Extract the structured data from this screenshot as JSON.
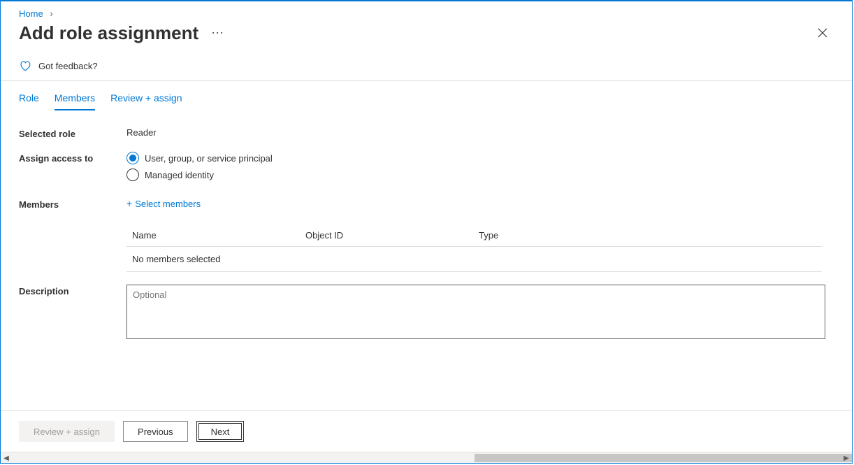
{
  "breadcrumb": {
    "home": "Home"
  },
  "title": "Add role assignment",
  "feedback": {
    "label": "Got feedback?"
  },
  "tabs": [
    {
      "key": "role",
      "label": "Role",
      "active": false
    },
    {
      "key": "members",
      "label": "Members",
      "active": true
    },
    {
      "key": "review",
      "label": "Review + assign",
      "active": false
    }
  ],
  "form": {
    "selected_role_label": "Selected role",
    "selected_role_value": "Reader",
    "assign_access_label": "Assign access to",
    "assign_access_options": [
      {
        "key": "usp",
        "label": "User, group, or service principal",
        "selected": true
      },
      {
        "key": "mi",
        "label": "Managed identity",
        "selected": false
      }
    ],
    "members_label": "Members",
    "select_members_link": "Select members",
    "members_table": {
      "headers": {
        "name": "Name",
        "object_id": "Object ID",
        "type": "Type"
      },
      "empty_text": "No members selected",
      "rows": []
    },
    "description_label": "Description",
    "description_placeholder": "Optional",
    "description_value": ""
  },
  "footer": {
    "review_assign": "Review + assign",
    "previous": "Previous",
    "next": "Next"
  }
}
